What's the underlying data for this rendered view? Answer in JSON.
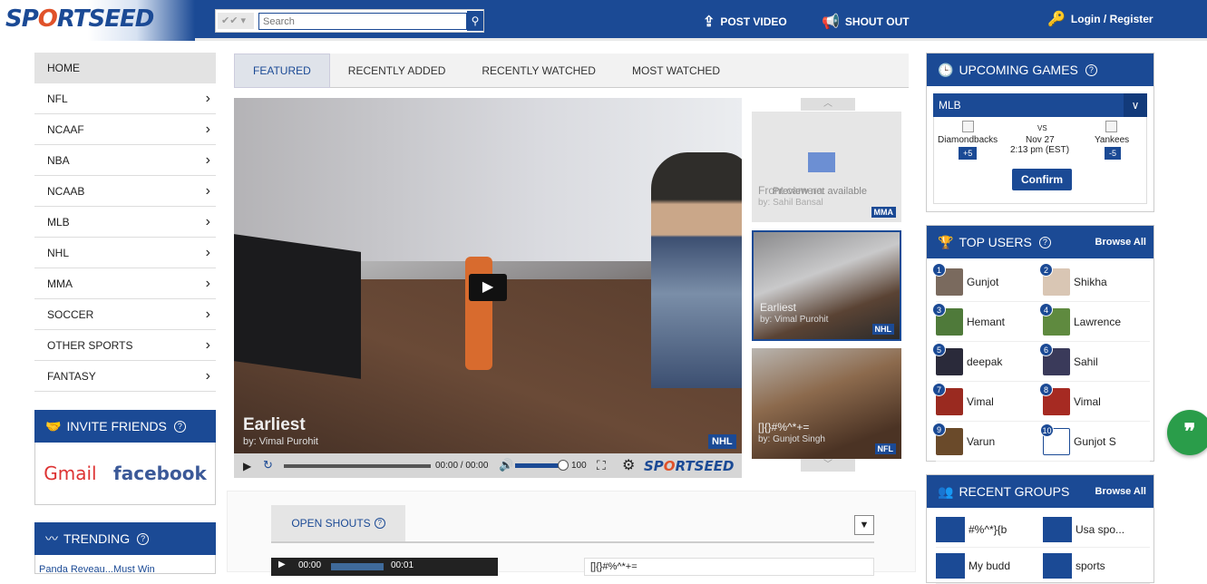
{
  "header": {
    "logo": "SPORTSEED",
    "search_placeholder": "Search",
    "post_video": "POST VIDEO",
    "shout_out": "SHOUT OUT",
    "login": "Login / Register"
  },
  "nav": {
    "home": "HOME",
    "items": [
      "NFL",
      "NCAAF",
      "NBA",
      "NCAAB",
      "MLB",
      "NHL",
      "MMA",
      "SOCCER",
      "OTHER SPORTS",
      "FANTASY"
    ]
  },
  "invite": {
    "title": "INVITE FRIENDS",
    "help": "?",
    "gmail": "Gmail",
    "facebook": "facebook"
  },
  "trending": {
    "title": "TRENDING",
    "help": "?",
    "first_item": "Panda Reveau...Must Win"
  },
  "tabs": [
    "FEATURED",
    "RECENTLY ADDED",
    "RECENTLY WATCHED",
    "MOST WATCHED"
  ],
  "video": {
    "title": "Earliest",
    "by": "by: Vimal Purohit",
    "badge": "NHL",
    "time": "00:00 / 00:00",
    "volume": "100",
    "brand": "SPORTSEED"
  },
  "thumbs": [
    {
      "title": "Front camera",
      "by": "by: Sahil Bansal",
      "badge": "MMA",
      "overlay": "Preview not available"
    },
    {
      "title": "Earliest",
      "by": "by: Vimal Purohit",
      "badge": "NHL"
    },
    {
      "title": "[]{}#%^*+=",
      "by": "by: Gunjot Singh",
      "badge": "NFL"
    }
  ],
  "shouts": {
    "tab": "OPEN SHOUTS",
    "help": "?",
    "mini_time1": "00:00",
    "mini_time2": "00:01",
    "text": "[]{}#%^*+="
  },
  "games": {
    "title": "UPCOMING GAMES",
    "help": "?",
    "league": "MLB",
    "team1": "Diamondbacks",
    "vs": "VS",
    "date": "Nov 27",
    "time": "2:13 pm (EST)",
    "team2": "Yankees",
    "spread1": "+5",
    "spread2": "-5",
    "confirm": "Confirm"
  },
  "top_users": {
    "title": "TOP USERS",
    "help": "?",
    "browse": "Browse All",
    "users": [
      {
        "rank": "1",
        "name": "Gunjot"
      },
      {
        "rank": "2",
        "name": "Shikha"
      },
      {
        "rank": "3",
        "name": "Hemant"
      },
      {
        "rank": "4",
        "name": "Lawrence"
      },
      {
        "rank": "5",
        "name": "deepak"
      },
      {
        "rank": "6",
        "name": "Sahil"
      },
      {
        "rank": "7",
        "name": "Vimal"
      },
      {
        "rank": "8",
        "name": "Vimal"
      },
      {
        "rank": "9",
        "name": "Varun"
      },
      {
        "rank": "10",
        "name": "Gunjot S"
      }
    ]
  },
  "groups": {
    "title": "RECENT GROUPS",
    "browse": "Browse All",
    "items": [
      {
        "name": "#%^*}{b"
      },
      {
        "name": "Usa spo..."
      },
      {
        "name": "My budd"
      },
      {
        "name": "sports"
      }
    ]
  },
  "quote_icon": "quote-icon"
}
